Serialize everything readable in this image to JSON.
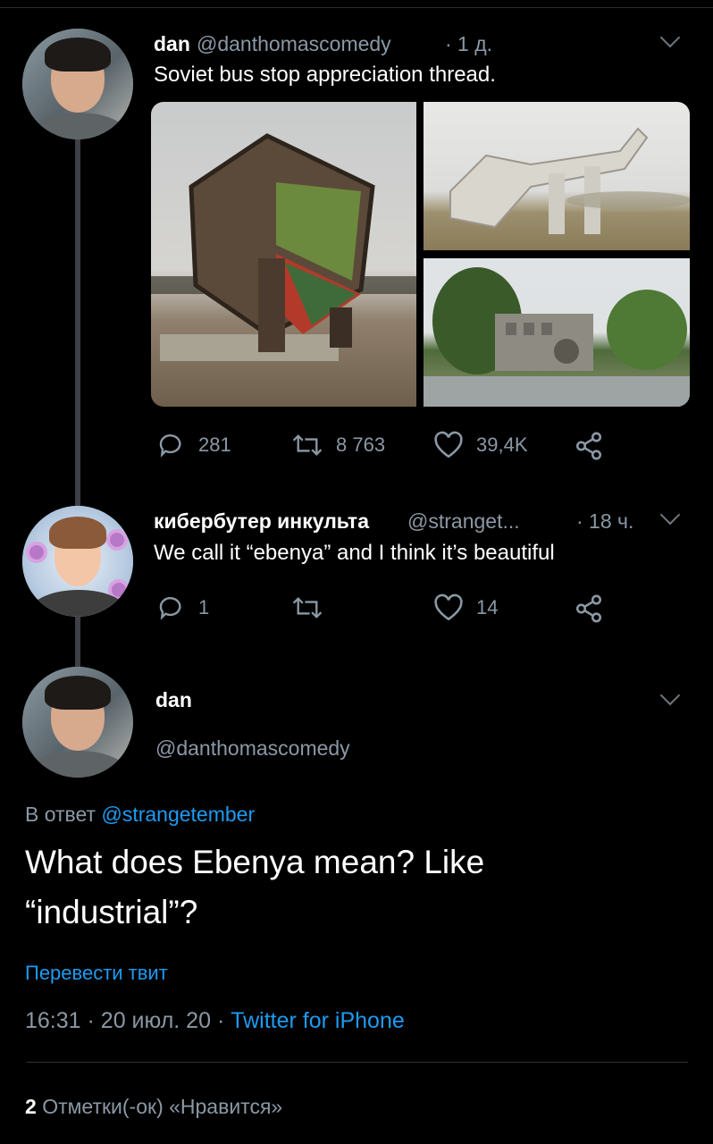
{
  "tweet1": {
    "name": "dan",
    "handle": "@danthomascomedy",
    "time": "· 1 д.",
    "text": "Soviet bus stop appreciation thread.",
    "stats": {
      "replies": "281",
      "retweets": "8 763",
      "likes": "39,4K"
    }
  },
  "tweet2": {
    "name": "кибербутер инкульта",
    "handle": "@stranget...",
    "time": "· 18 ч.",
    "text": "We call it “ebenya” and I think it’s beautiful",
    "stats": {
      "replies": "1",
      "likes": "14"
    }
  },
  "main": {
    "name": "dan",
    "handle": "@danthomascomedy",
    "reply_prefix": "В ответ",
    "reply_to": "@strangetember",
    "text_line1": "What does Ebenya mean? Like",
    "text_line2": "“industrial”?",
    "translate": "Перевести твит",
    "time": "16:31",
    "date": "· 20 июл. 20 ·",
    "source": "Twitter for iPhone",
    "likes_count": "2",
    "likes_label": "Отметки(-ок) «Нравится»"
  },
  "icons": {
    "reply": "reply-icon",
    "retweet": "retweet-icon",
    "like": "heart-icon",
    "share": "share-icon",
    "more": "chevron-down-icon"
  },
  "colors": {
    "accent": "#1d9bf0",
    "muted": "#8b98a5",
    "background": "#000000"
  }
}
